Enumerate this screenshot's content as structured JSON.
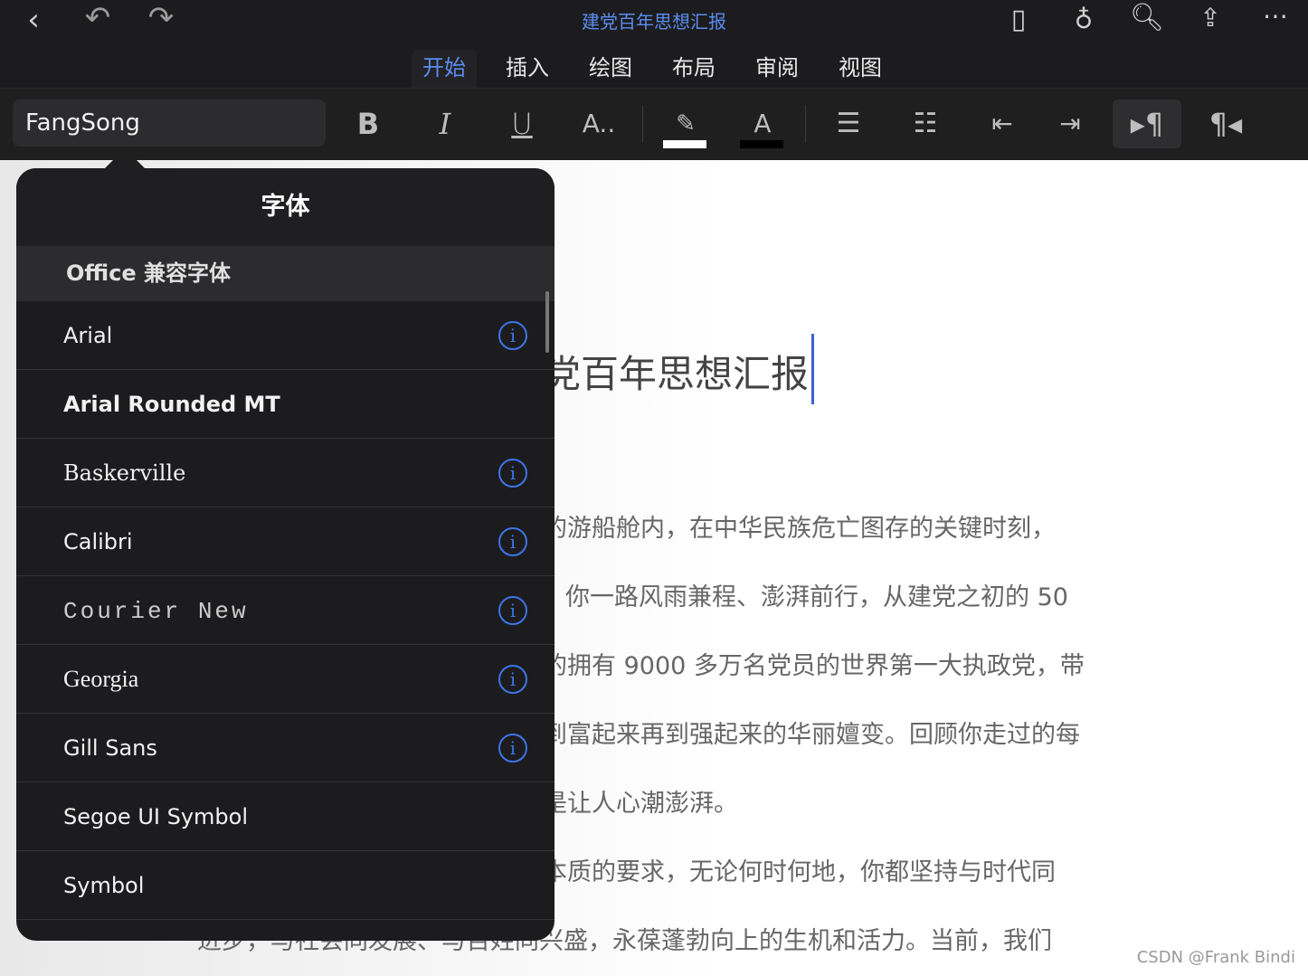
{
  "header": {
    "title": "建党百年思想汇报",
    "tabs": [
      {
        "label": "开始",
        "active": true
      },
      {
        "label": "插入"
      },
      {
        "label": "绘图"
      },
      {
        "label": "布局"
      },
      {
        "label": "审阅"
      },
      {
        "label": "视图"
      }
    ]
  },
  "toolbar": {
    "font": "FangSong",
    "bold": "B",
    "italic": "I",
    "underline": "U",
    "text_effects": "A..",
    "font_color_letter": "A",
    "highlight_color": "#ffffff",
    "font_color": "#000000"
  },
  "document": {
    "title": "党百年思想汇报",
    "lines": [
      "的游船舱内，在中华民族危亡图存的关键时刻，",
      "你一路风雨兼程、澎湃前行，从建党之初的 50",
      "的拥有 9000 多万名党员的世界第一大执政党，带",
      "到富起来再到强起来的华丽嬗变。回顾你走过的每",
      "是让人心潮澎湃。",
      "本质的要求，无论何时何地，你都坚持与时代同",
      "进步，与社会同发展、与百姓同兴盛，永葆蓬勃向上的生机和活力。当前，我们"
    ]
  },
  "popover": {
    "title": "字体",
    "section": "Office 兼容字体",
    "fonts": [
      {
        "name": "Arial",
        "info": true
      },
      {
        "name": "Arial Rounded MT",
        "info": false
      },
      {
        "name": "Baskerville",
        "info": true
      },
      {
        "name": "Calibri",
        "info": true
      },
      {
        "name": "Courier New",
        "info": true
      },
      {
        "name": "Georgia",
        "info": true
      },
      {
        "name": "Gill Sans",
        "info": true
      },
      {
        "name": "Segoe UI Symbol",
        "info": false
      },
      {
        "name": "Symbol",
        "info": false
      }
    ]
  },
  "watermark": "CSDN @Frank Bindi",
  "accent": "#5b8cf0"
}
